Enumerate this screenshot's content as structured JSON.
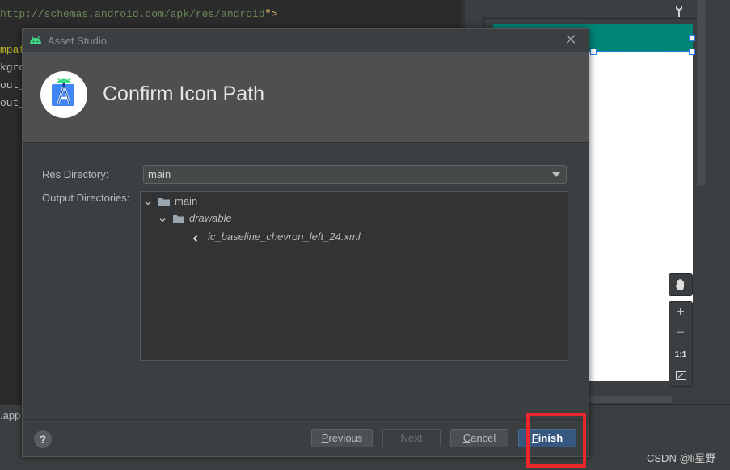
{
  "ide": {
    "code_lines": [
      {
        "text": "http://schemas.android.com/apk/res/android",
        "suffix": "\">"
      },
      {
        "text": "mpat"
      },
      {
        "text": "kgro"
      },
      {
        "text": "out_"
      },
      {
        "text": "out_"
      }
    ],
    "app_label": ".app",
    "zoom_controls": [
      "pan-hand-icon",
      "+",
      "−",
      "1:1",
      "fit-screen-icon"
    ],
    "watermark": "CSDN @li星野"
  },
  "dialog": {
    "title": "Asset Studio",
    "heading": "Confirm Icon Path",
    "res_directory_label": "Res Directory:",
    "res_directory_value": "main",
    "output_directories_label": "Output Directories:",
    "tree": [
      {
        "level": 0,
        "type": "folder",
        "label": "main",
        "italic": false
      },
      {
        "level": 1,
        "type": "folder",
        "label": "drawable",
        "italic": true
      },
      {
        "level": 2,
        "type": "file",
        "label": "ic_baseline_chevron_left_24.xml",
        "italic": true
      }
    ],
    "buttons": {
      "help": "?",
      "previous_first": "P",
      "previous_rest": "revious",
      "next": "Next",
      "cancel_first": "C",
      "cancel_rest": "ancel",
      "finish_first": "F",
      "finish_rest": "inish"
    }
  },
  "colors": {
    "highlight_box": "#e8262b",
    "primary_button": "#365880",
    "toolbar_teal": "#008577"
  }
}
